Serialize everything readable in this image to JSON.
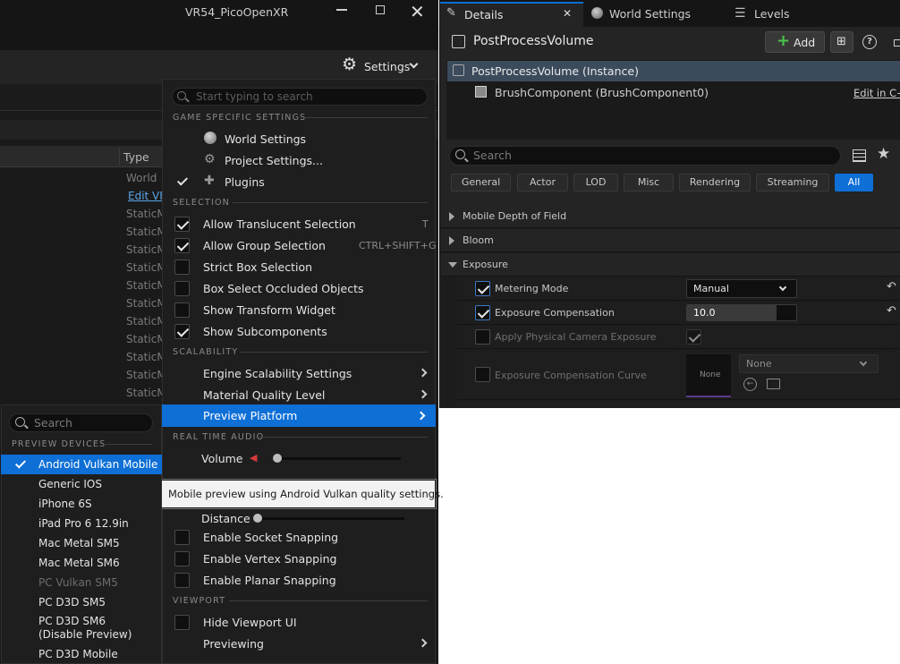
{
  "window": {
    "title": "VR54_PicoOpenXR",
    "settings_label": "Settings"
  },
  "list": {
    "type_header": "Type",
    "type_values": [
      "World",
      "Edit VF",
      "StaticM",
      "StaticM",
      "StaticM",
      "StaticM",
      "StaticM",
      "StaticM",
      "StaticM",
      "StaticM",
      "StaticM",
      "StaticM",
      "StaticM"
    ]
  },
  "settings_menu": {
    "search_placeholder": "Start typing to search",
    "sections": {
      "game": "GAME SPECIFIC SETTINGS",
      "selection": "SELECTION",
      "scalability": "SCALABILITY",
      "audio": "REAL TIME AUDIO",
      "viewport": "VIEWPORT"
    },
    "world_settings": "World Settings",
    "project_settings": "Project Settings...",
    "plugins": "Plugins",
    "allow_translucent": "Allow Translucent Selection",
    "allow_translucent_key": "T",
    "allow_group": "Allow Group Selection",
    "allow_group_key": "CTRL+SHIFT+G",
    "strict_box": "Strict Box Selection",
    "box_occluded": "Box Select Occluded Objects",
    "show_transform": "Show Transform Widget",
    "show_subcomponents": "Show Subcomponents",
    "engine_scalability": "Engine Scalability Settings",
    "material_quality": "Material Quality Level",
    "preview_platform": "Preview Platform",
    "volume": "Volume",
    "volume_level": 0.0,
    "distance": "Distance",
    "distance_level": 0.0,
    "socket_snapping": "Enable Socket Snapping",
    "vertex_snapping": "Enable Vertex Snapping",
    "planar_snapping": "Enable Planar Snapping",
    "hide_viewport": "Hide Viewport UI",
    "previewing": "Previewing"
  },
  "tooltip": "Mobile preview using Android Vulkan quality settings.",
  "preview_menu": {
    "search_placeholder": "Search",
    "section": "PREVIEW DEVICES",
    "devices": [
      "Android Vulkan Mobile",
      "Generic IOS",
      "iPhone 6S",
      "iPad Pro 6 12.9in",
      "Mac Metal SM5",
      "Mac Metal SM6",
      "PC Vulkan SM5",
      "PC D3D SM5",
      "PC D3D SM6",
      "(Disable Preview)",
      "PC D3D Mobile"
    ]
  },
  "details": {
    "tabs": [
      "Details",
      "World Settings",
      "Levels"
    ],
    "title": "PostProcessVolume",
    "add_label": "Add",
    "instance_label": "PostProcessVolume (Instance)",
    "brush_label": "BrushComponent (BrushComponent0)",
    "edit_link": "Edit in C+",
    "search_placeholder": "Search",
    "filters": [
      "General",
      "Actor",
      "LOD",
      "Misc",
      "Rendering",
      "Streaming",
      "All"
    ],
    "groups": [
      "Mobile Depth of Field",
      "Bloom",
      "Exposure"
    ],
    "props": {
      "metering_mode": "Metering Mode",
      "metering_value": "Manual",
      "exposure_comp": "Exposure Compensation",
      "exposure_value": "10.0",
      "apply_physical": "Apply Physical Camera Exposure",
      "comp_curve": "Exposure Compensation Curve",
      "curve_thumb": "None",
      "curve_value": "None"
    }
  },
  "colors": {
    "accent": "#0e6fd6",
    "panel": "#242424",
    "menu": "#1e1e1e"
  }
}
